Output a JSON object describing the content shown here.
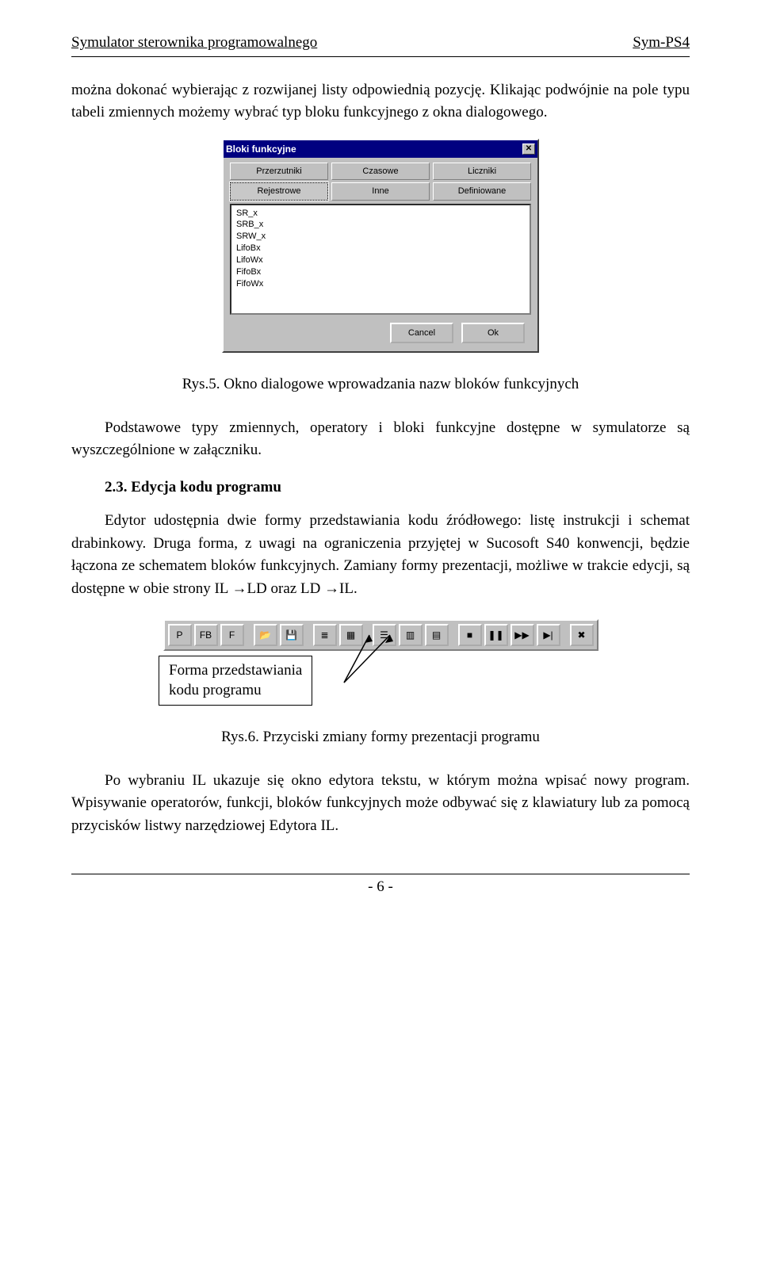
{
  "header": {
    "left": "Symulator sterownika programowalnego",
    "right": "Sym-PS4"
  },
  "para1": "można dokonać wybierając z rozwijanej listy odpowiednią pozycję. Klikając podwójnie na pole typu tabeli zmiennych możemy wybrać typ bloku funkcyjnego z okna dialogowego.",
  "dialog": {
    "title": "Bloki funkcyjne",
    "close": "✕",
    "tabs_row1": [
      "Przerzutniki",
      "Czasowe",
      "Liczniki"
    ],
    "tabs_row2": [
      "Rejestrowe",
      "Inne",
      "Definiowane"
    ],
    "list": [
      "SR_x",
      "SRB_x",
      "SRW_x",
      "LifoBx",
      "LifoWx",
      "FifoBx",
      "FifoWx"
    ],
    "cancel": "Cancel",
    "ok": "Ok"
  },
  "fig5": "Rys.5. Okno dialogowe wprowadzania nazw bloków funkcyjnych",
  "para2": "Podstawowe typy zmiennych, operatory i bloki funkcyjne dostępne w symulatorze są wyszczególnione w załączniku.",
  "section": "2.3. Edycja kodu programu",
  "para3": "Edytor udostępnia dwie formy przedstawiania kodu źródłowego: listę instrukcji i schemat drabinkowy. Druga forma, z uwagi na ograniczenia przyjętej w Sucosoft S40 konwencji, będzie łączona ze schematem bloków funkcyjnych. Zamiany formy prezentacji, możliwe w trakcie edycji, są dostępne w obie strony IL →LD oraz LD →IL.",
  "toolbar": {
    "buttons": [
      "P",
      "FB",
      "F",
      "📂",
      "💾",
      "≣",
      "▦",
      "☰",
      "▥",
      "▤",
      "■",
      "❚❚",
      "▶▶",
      "▶|",
      "✖"
    ],
    "annot": "Forma przedstawiania\nkodu programu"
  },
  "fig6": "Rys.6. Przyciski zmiany formy prezentacji programu",
  "para4": "Po wybraniu IL ukazuje się okno edytora tekstu, w którym można wpisać nowy program. Wpisywanie operatorów, funkcji, bloków funkcyjnych może odbywać się z klawiatury lub za pomocą przycisków listwy narzędziowej  Edytora IL.",
  "pagenum": "- 6 -"
}
